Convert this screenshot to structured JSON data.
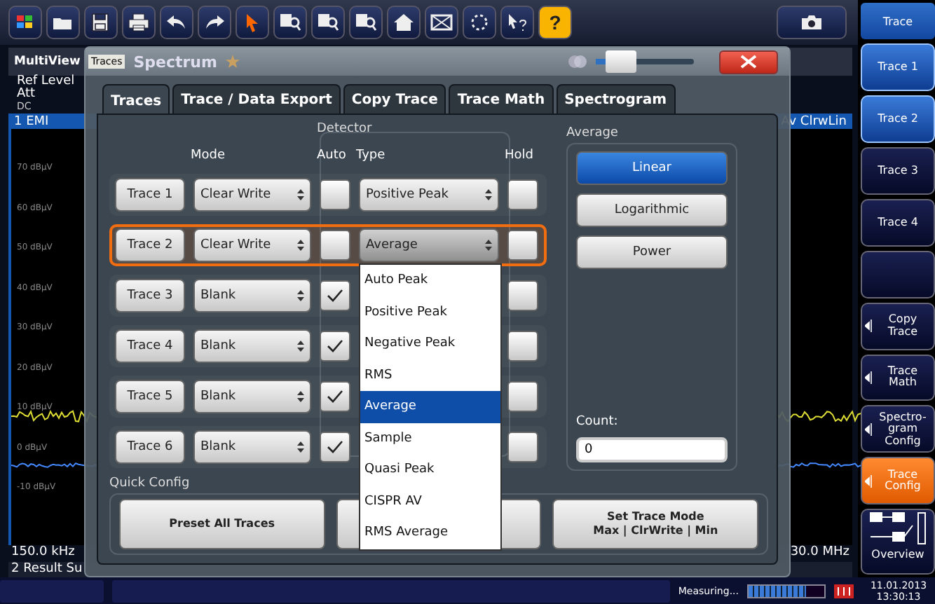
{
  "toolbar": {
    "help_label": "?"
  },
  "softkeys": {
    "title": "Trace",
    "items": [
      {
        "label": "Trace 1",
        "kind": "plain",
        "on": true,
        "selected": false
      },
      {
        "label": "Trace 2",
        "kind": "plain",
        "on": true,
        "selected": false
      },
      {
        "label": "Trace 3",
        "kind": "plain",
        "on": false,
        "selected": false
      },
      {
        "label": "Trace 4",
        "kind": "plain",
        "on": false,
        "selected": false
      },
      {
        "kind": "empty",
        "on": false,
        "selected": false
      },
      {
        "label": "Copy Trace",
        "kind": "submenu",
        "on": false,
        "selected": false
      },
      {
        "label": "Trace Math",
        "kind": "submenu",
        "on": false,
        "selected": false
      },
      {
        "label": "Spectro-gram Config",
        "kind": "submenu",
        "on": false,
        "selected": false
      },
      {
        "label": "Trace Config",
        "kind": "submenu",
        "on": false,
        "selected": true
      },
      {
        "label": "Overview",
        "kind": "overview",
        "on": false,
        "selected": false
      }
    ]
  },
  "multiview": {
    "title": "MultiView",
    "tab": "Spectrum",
    "ref_level": "Ref Level",
    "att": "Att",
    "coupling": "DC",
    "trace_label": "1 EMI",
    "trace_info": "Av ClrwLin",
    "y_labels": [
      "70 dBµV",
      "60 dBµV",
      "50 dBµV",
      "40 dBµV",
      "30 dBµV",
      "20 dBµV",
      "10 dBµV",
      "0 dBµV",
      "-10 dBµV"
    ],
    "x_start": "150.0 kHz",
    "x_stop": "30.0 MHz",
    "result_title": "2 Result Su"
  },
  "dialog": {
    "title": "Traces",
    "transparency": {
      "level": 0.25
    },
    "tabs": [
      {
        "label": "Traces",
        "selected": true
      },
      {
        "label": "Trace / Data Export",
        "selected": false
      },
      {
        "label": "Copy Trace",
        "selected": false
      },
      {
        "label": "Trace Math",
        "selected": false
      },
      {
        "label": "Spectrogram",
        "selected": false
      }
    ],
    "detector_title": "Detector",
    "headers": {
      "mode": "Mode",
      "auto": "Auto",
      "type": "Type",
      "hold": "Hold"
    },
    "rows": [
      {
        "trace": "Trace 1",
        "mode": "Clear Write",
        "auto": false,
        "type": "Positive Peak",
        "hold": false,
        "selected": false
      },
      {
        "trace": "Trace 2",
        "mode": "Clear Write",
        "auto": false,
        "type": "Average",
        "hold": false,
        "selected": true
      },
      {
        "trace": "Trace 3",
        "mode": "Blank",
        "auto": true,
        "hold": false,
        "selected": false
      },
      {
        "trace": "Trace 4",
        "mode": "Blank",
        "auto": true,
        "hold": false,
        "selected": false
      },
      {
        "trace": "Trace 5",
        "mode": "Blank",
        "auto": true,
        "hold": false,
        "selected": false
      },
      {
        "trace": "Trace 6",
        "mode": "Blank",
        "auto": true,
        "hold": false,
        "selected": false
      }
    ],
    "type_dropdown": {
      "items": [
        {
          "label": "Auto Peak",
          "selected": false
        },
        {
          "label": "Positive Peak",
          "selected": false
        },
        {
          "label": "Negative Peak",
          "selected": false
        },
        {
          "label": "RMS",
          "selected": false
        },
        {
          "label": "Average",
          "selected": true
        },
        {
          "label": "Sample",
          "selected": false
        },
        {
          "label": "Quasi Peak",
          "selected": false
        },
        {
          "label": "CISPR AV",
          "selected": false
        },
        {
          "label": "RMS Average",
          "selected": false
        }
      ]
    },
    "average": {
      "title": "Average",
      "options": [
        {
          "label": "Linear",
          "selected": true
        },
        {
          "label": "Logarithmic",
          "selected": false
        },
        {
          "label": "Power",
          "selected": false
        }
      ],
      "count_label": "Count:",
      "count_value": "0"
    },
    "quick_config": {
      "title": "Quick Config",
      "buttons": [
        {
          "kind": "text",
          "lines": [
            "Preset All Traces"
          ]
        },
        {
          "kind": "covered"
        },
        {
          "kind": "text",
          "lines": [
            "Set Trace Mode",
            "Max | ClrWrite | Min"
          ]
        }
      ]
    }
  },
  "status_bar": {
    "text": "Measuring...",
    "progress": {
      "level": 0.75
    },
    "date": "11.01.2013",
    "time": "13:30:13"
  }
}
